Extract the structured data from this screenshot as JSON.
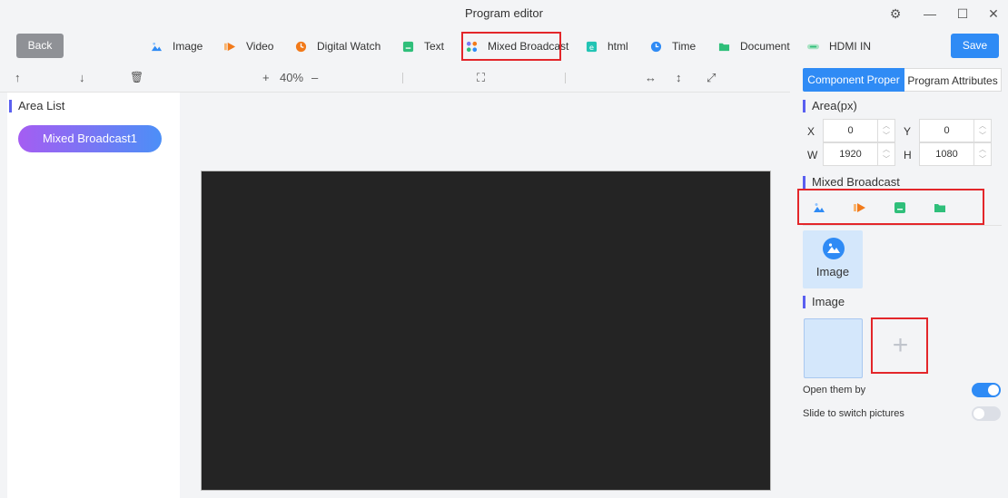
{
  "window": {
    "title": "Program editor",
    "controls": {
      "settings": "⚙",
      "minimize": "—",
      "maximize": "☐",
      "close": "✕"
    }
  },
  "toolbar": {
    "back_label": "Back",
    "save_label": "Save",
    "items": [
      {
        "label": "Image",
        "icon": "image-icon",
        "color": "#2f8bf5"
      },
      {
        "label": "Video",
        "icon": "video-icon",
        "color": "#f27a1a"
      },
      {
        "label": "Digital Watch",
        "icon": "clock-icon",
        "color": "#f27a1a"
      },
      {
        "label": "Text",
        "icon": "text-icon",
        "color": "#2fbf7a"
      },
      {
        "label": "Mixed Broadcast",
        "icon": "grid-icon",
        "color": "#7a7af5"
      },
      {
        "label": "html",
        "icon": "html-icon",
        "color": "#22c4b4"
      },
      {
        "label": "Time",
        "icon": "time-icon",
        "color": "#2f8bf5"
      },
      {
        "label": "Document",
        "icon": "folder-icon",
        "color": "#2fbf7a"
      },
      {
        "label": "HDMI IN",
        "icon": "hdmi-icon",
        "color": "#2fbf7a"
      }
    ]
  },
  "subbar": {
    "up": "↑",
    "down": "↓",
    "delete": "🗑",
    "zoom_in": "+",
    "zoom_level": "40%",
    "zoom_out": "–",
    "fit": "⛶",
    "fit_width": "↔",
    "fit_height": "↕",
    "fullscreen": "⤢"
  },
  "left_panel": {
    "title": "Area List",
    "areas": [
      "Mixed Broadcast1"
    ]
  },
  "right_panel": {
    "tabs": [
      "Component Proper",
      "Program Attributes"
    ],
    "area_title": "Area(px)",
    "x_label": "X",
    "x_value": "0",
    "y_label": "Y",
    "y_value": "0",
    "w_label": "W",
    "w_value": "1920",
    "h_label": "H",
    "h_value": "1080",
    "mixed_title": "Mixed Broadcast",
    "selected_type": "Image",
    "image_title": "Image",
    "add_symbol": "+",
    "open_label": "Open them by",
    "open_on": true,
    "slide_label": "Slide to switch pictures",
    "slide_on": false
  },
  "colors": {
    "accent": "#2f8bf5",
    "highlight": "#e3262a",
    "toggle_off": "#dcdfe6"
  }
}
